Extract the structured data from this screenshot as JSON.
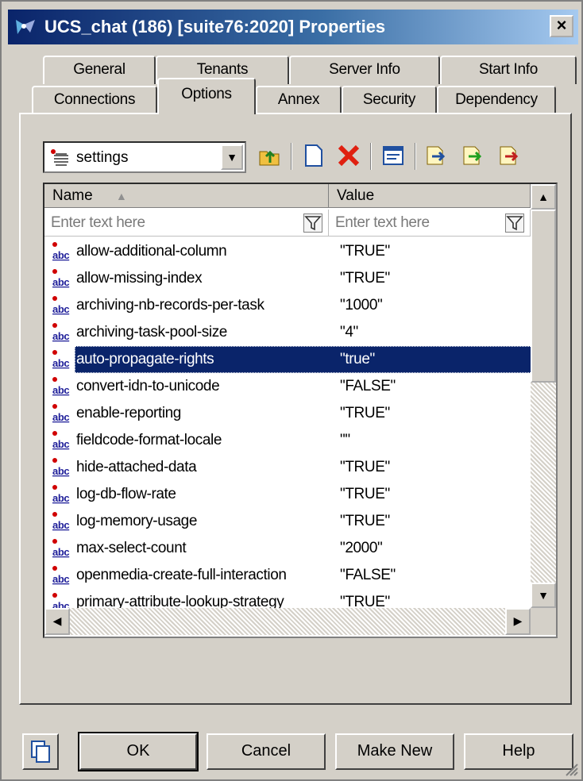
{
  "window": {
    "title": "UCS_chat (186) [suite76:2020] Properties",
    "close_label": "×"
  },
  "tabs": {
    "row1": [
      "General",
      "Tenants",
      "Server Info",
      "Start Info"
    ],
    "row2": [
      "Connections",
      "Options",
      "Annex",
      "Security",
      "Dependency"
    ],
    "active": "Options"
  },
  "toolbar": {
    "section_selector_value": "settings"
  },
  "grid": {
    "columns": [
      "Name",
      "Value"
    ],
    "filter_placeholder_name": "Enter text here",
    "filter_placeholder_value": "Enter text here",
    "rows": [
      {
        "name": "allow-additional-column",
        "value": "\"TRUE\""
      },
      {
        "name": "allow-missing-index",
        "value": "\"TRUE\""
      },
      {
        "name": "archiving-nb-records-per-task",
        "value": "\"1000\""
      },
      {
        "name": "archiving-task-pool-size",
        "value": "\"4\""
      },
      {
        "name": "auto-propagate-rights",
        "value": "\"true\"",
        "selected": true
      },
      {
        "name": "convert-idn-to-unicode",
        "value": "\"FALSE\""
      },
      {
        "name": "enable-reporting",
        "value": "\"TRUE\""
      },
      {
        "name": "fieldcode-format-locale",
        "value": "\"\""
      },
      {
        "name": "hide-attached-data",
        "value": "\"TRUE\""
      },
      {
        "name": "log-db-flow-rate",
        "value": "\"TRUE\""
      },
      {
        "name": "log-memory-usage",
        "value": "\"TRUE\""
      },
      {
        "name": "max-select-count",
        "value": "\"2000\""
      },
      {
        "name": "openmedia-create-full-interaction",
        "value": "\"FALSE\""
      },
      {
        "name": "primary-attribute-lookup-strategy",
        "value": "\"TRUE\""
      }
    ]
  },
  "buttons": {
    "ok": "OK",
    "cancel": "Cancel",
    "make_new": "Make New",
    "help": "Help"
  },
  "colors": {
    "title_start": "#0a246a",
    "title_end": "#a6caf0",
    "selection": "#0a246a",
    "face": "#d4d0c8",
    "delete_red": "#e02010"
  }
}
